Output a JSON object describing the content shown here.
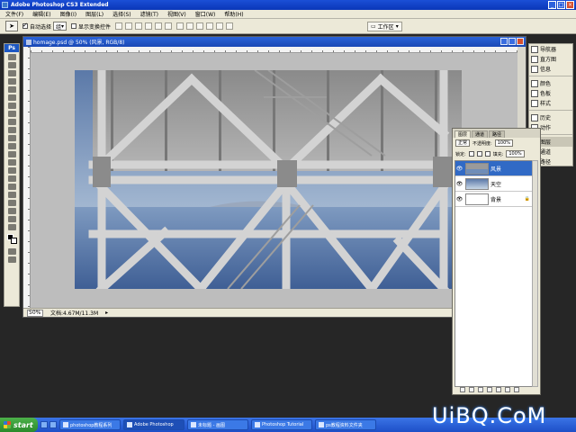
{
  "window": {
    "title": "Adobe Photoshop CS3 Extended"
  },
  "menu": [
    "文件(F)",
    "编辑(E)",
    "图像(I)",
    "图层(L)",
    "选择(S)",
    "滤镜(T)",
    "视图(V)",
    "窗口(W)",
    "帮助(H)"
  ],
  "options": {
    "auto_select_label": "自动选择",
    "auto_select_target": "组",
    "show_transform_label": "显示变换控件",
    "workspace_label": "工作区"
  },
  "document": {
    "title": "homage.psd @ 50% (风景, RGB/8)",
    "zoom": "50%",
    "status": "文档:4.67M/11.3M"
  },
  "dock": {
    "items": [
      "导航器",
      "直方图",
      "信息",
      "颜色",
      "色板",
      "样式",
      "历史",
      "动作",
      "图层",
      "通道",
      "路径"
    ]
  },
  "layers_panel": {
    "tabs": [
      "图层",
      "通道",
      "路径"
    ],
    "blend_mode": "正常",
    "opacity_label": "不透明度:",
    "opacity": "100%",
    "lock_label": "锁定:",
    "fill_label": "填充:",
    "fill": "100%",
    "layers": [
      {
        "name": "风景",
        "selected": true
      },
      {
        "name": "天空",
        "selected": false
      },
      {
        "name": "背景",
        "selected": false,
        "locked": true
      }
    ]
  },
  "taskbar": {
    "start_label": "start",
    "buttons": [
      "photoshop教程系列",
      "Adobe Photoshop",
      "未标题 - 画图",
      "Photoshop Tutorial",
      "ps教程资料文件夹"
    ]
  },
  "watermark": "UiBQ.CoM",
  "colors": {
    "titlebar": "#0a36b8",
    "selection": "#316ac5",
    "taskbar": "#1d4fc7",
    "start": "#2a8a2b"
  }
}
